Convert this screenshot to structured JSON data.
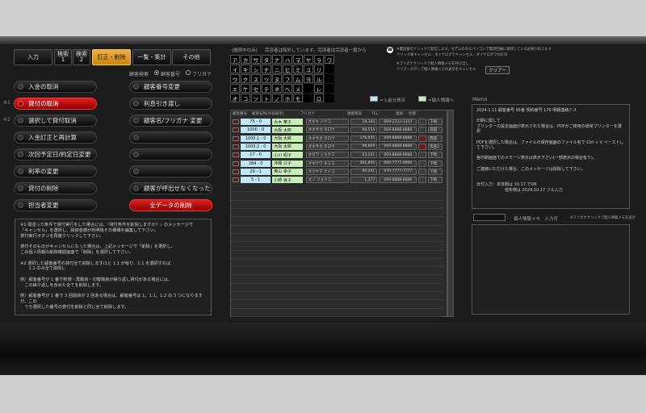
{
  "tabs": [
    {
      "label": "入力"
    },
    {
      "label": "検索\n1"
    },
    {
      "label": "検索\n2"
    },
    {
      "label": "訂正・削除"
    },
    {
      "label": "一覧・集計"
    },
    {
      "label": "その他"
    }
  ],
  "search_options": {
    "label": "顧客検索",
    "option1": "顧客番号",
    "option2": "フリガナ"
  },
  "left_buttons": [
    {
      "label": "入金の取消",
      "red": false
    },
    {
      "label": "貸付の取消",
      "red": true
    },
    {
      "label": "選択して貸付取消",
      "red": false
    },
    {
      "label": "入金訂正と再計算",
      "red": false
    },
    {
      "label": "次回予定日/約定日変更",
      "red": false
    },
    {
      "label": "利率の変更",
      "red": false
    },
    {
      "label": "貸付の削除",
      "red": false
    },
    {
      "label": "担当者変更",
      "red": false
    }
  ],
  "right_buttons": [
    {
      "label": "顧客番号変更",
      "red": false
    },
    {
      "label": "利息引き渡し",
      "red": false
    },
    {
      "label": "顧客名/フリガナ 変更",
      "red": false
    },
    {
      "label": "",
      "red": false
    },
    {
      "label": "",
      "red": false
    },
    {
      "label": "",
      "red": false
    },
    {
      "label": "顧客が呼出せなくなった",
      "red": false
    },
    {
      "label": "全データの削除",
      "red": true
    }
  ],
  "side_notes": {
    "n1": "※1",
    "n2": "※2"
  },
  "notes_text": "※1 間違った条件で貸付実行をした場合には、『貸付条件を削除しますか？』のメッセージで\n「キャンセル」を選択し、融資金額が判明後その欄欄を編集して下さい。\n貸付実行ボタンを再度クリックして下さい。\n\n貸付そのものがキャンセルになった場合は、上記メッセージで「削除」を選択し、\nこの個人情報の削除確認画面で「削除」を選択して下さい。\n\n※2 選択した顧客番号の貸付全て削除します(1と 1.1 が有り、1.1 を選択すれば\n　　1.1 のみ全て削除)。\n\n例）顧客番号が 1 番で新規・再融資・切替融資が繰り返し貸付がある場合には、\n　この繰り返しを含めた全てを削除します。\n\n例）顧客番号が 1 番で 3 回融資が 2 回ある場合は、顧客番号は 1、1.1、1.2 の 3 つになりますが、この\n　うち選択した番号の貸付を削除と同じ全て削除します。",
  "search_header": {
    "left": "(融資中のみ)",
    "mid": "完済者は除外しています。完済者は完済者一覧から"
  },
  "kana": [
    "ア",
    "カ",
    "サ",
    "タ",
    "ナ",
    "ハ",
    "マ",
    "ヤ",
    "ラ",
    "ワ",
    "イ",
    "キ",
    "シ",
    "チ",
    "ニ",
    "ヒ",
    "ミ",
    "ユ",
    "リ",
    "",
    "ウ",
    "ク",
    "ス",
    "ツ",
    "ヌ",
    "フ",
    "ム",
    "ヨ",
    "ル",
    "",
    "エ",
    "ケ",
    "セ",
    "テ",
    "ネ",
    "ヘ",
    "メ",
    "",
    "レ",
    "",
    "オ",
    "コ",
    "ソ",
    "ト",
    "ノ",
    "ホ",
    "モ",
    "",
    "ロ",
    ""
  ],
  "legend": {
    "blue": "=入金分表示",
    "green": "=個人情報へ"
  },
  "table_headers": [
    "顧客番号",
    "顧客名称(外部表示)",
    "フリガナ",
    "融資残高",
    "TEL",
    "連絡",
    "状態"
  ],
  "rows": [
    {
      "id": "75 - 0",
      "name": "大木 華子",
      "kana": "オオキ ハナコ",
      "amount": "18,183",
      "tel": "069-2222-3333",
      "mark": false,
      "status": "下地"
    },
    {
      "id": "1000 - 0",
      "name": "大阪 太郎",
      "kana": "オオサカ タロウ",
      "amount": "98,554",
      "tel": "069-8888-8888",
      "mark": false,
      "status": "前田"
    },
    {
      "id": "1000.1 - 0",
      "name": "大阪 太郎",
      "kana": "オオサカ タロウ",
      "amount": "276,035",
      "tel": "069-8888-8888",
      "mark": true,
      "status": "西島"
    },
    {
      "id": "1000.2 - 0",
      "name": "大阪 太郎",
      "kana": "オオサカ タロウ",
      "amount": "99,869",
      "tel": "069-8888-8888",
      "mark": true,
      "status": "伝名2"
    },
    {
      "id": "17 - 0",
      "name": "小川 昭子",
      "kana": "オガワ ショウコ",
      "amount": "63,241",
      "tel": "069-8888-8888",
      "mark": false,
      "status": "下地"
    },
    {
      "id": "184 - 0",
      "name": "沖縄 公子",
      "kana": "オキナワ キミコ",
      "amount": "461,895",
      "tel": "069-7777-9999",
      "mark": false,
      "status": "下地"
    },
    {
      "id": "29 - 1",
      "name": "奥山 幸子",
      "kana": "オクヤマ ケイコ",
      "amount": "89,201",
      "tel": "070-7777-7777",
      "mark": false,
      "status": "下地"
    },
    {
      "id": "5 - 1",
      "name": "小野 良子",
      "kana": "オノ リョウコ",
      "amount": "1,377",
      "tel": "069-8888-8888",
      "mark": false,
      "status": "下地"
    }
  ],
  "phone_note": {
    "line1": "※電話番号クリックで発信します。モデムのあるパソコンで電話回線に接続している必要があります",
    "line2": "クリック後キャンセル：ダイヤログでキャンセル／ダイヤログで[OK]を",
    "line3": "※フリガナクリックで個人情報メモを呼び出し",
    "line4": "クリアーボタンで個人情報メモの表示をキャンセル",
    "clear": "クリアー"
  },
  "memo": {
    "label": "Memo",
    "text": "2024.1.11 顧客番号 95番 契約番号 179 明細連絡ミス\n\n印刷に関して\nプリンターの設定画面が表示された場合は、PDFかご使用の通常プリンターを選択\n\nPDFを選択した場合は、ファイルの保存画面のファイル名で Ctrl + V ペーストして下さい。\n\n各印刷画面でのメモージ表示は表示下さい(一部表示の場合有り)。\n\nご連絡いただけた場合、このメッセージは削除して下さい。\n\n\n日付入力：本体側は 10.17 でOK\n　　　　　　　他年側は 2024.10.17 フル入力"
  },
  "info_memo": {
    "label": "個人情報メモ　入力可",
    "note": "※フリガナクリックで個人情報メモを表示"
  }
}
